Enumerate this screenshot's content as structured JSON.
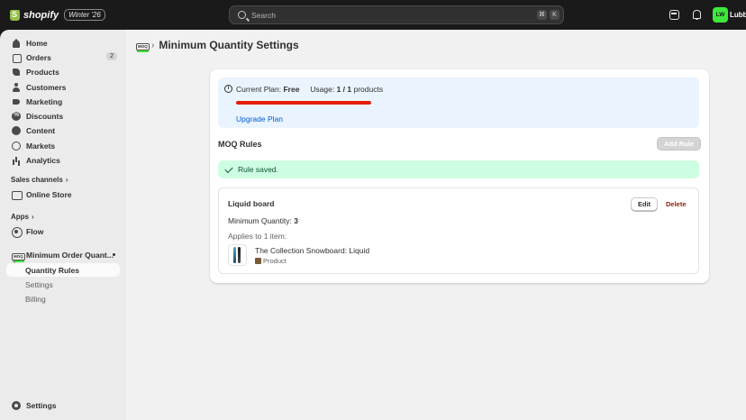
{
  "topbar": {
    "brand": "shopify",
    "version": "Winter '26",
    "search_placeholder": "Search",
    "kbd_cmd": "⌘",
    "kbd_k": "K",
    "avatar_initials": "LW",
    "account_name": "Lubbe"
  },
  "sidebar": {
    "items": [
      {
        "label": "Home",
        "icon": "home-icon"
      },
      {
        "label": "Orders",
        "icon": "orders-icon",
        "count": "2"
      },
      {
        "label": "Products",
        "icon": "tag-icon"
      },
      {
        "label": "Customers",
        "icon": "person-icon"
      },
      {
        "label": "Marketing",
        "icon": "megaphone-icon"
      },
      {
        "label": "Discounts",
        "icon": "discount-icon"
      },
      {
        "label": "Content",
        "icon": "content-icon"
      },
      {
        "label": "Markets",
        "icon": "globe-icon"
      },
      {
        "label": "Analytics",
        "icon": "chart-icon"
      }
    ],
    "sales_channels_label": "Sales channels",
    "online_store_label": "Online Store",
    "apps_label": "Apps",
    "flow_label": "Flow",
    "app_name": "Minimum Order Quant...",
    "moq_badge": "MOQ",
    "app_sub_items": [
      "Quantity Rules",
      "Settings",
      "Billing"
    ],
    "settings_label": "Settings"
  },
  "page": {
    "title": "Minimum Quantity Settings",
    "plan": {
      "current_plan_label": "Current Plan:",
      "current_plan_value": "Free",
      "usage_label": "Usage:",
      "usage_value": "1 / 1",
      "usage_unit": "products",
      "usage_fraction": 1.0,
      "upgrade_link": "Upgrade Plan"
    },
    "rules_title": "MOQ Rules",
    "add_rule_label": "Add Rule",
    "success_message": "Rule saved.",
    "rule": {
      "name": "Liquid board",
      "edit_label": "Edit",
      "delete_label": "Delete",
      "min_qty_label": "Minimum Quantity:",
      "min_qty_value": "3",
      "applies_text": "Applies to 1 item:",
      "product_name": "The Collection Snowboard: Liquid",
      "product_type": "Product"
    }
  },
  "colors": {
    "accent_link": "#005bd3",
    "progress_fill": "#e51c00",
    "success_bg": "#cdfee1",
    "info_bg": "#eaf4ff",
    "avatar_bg": "#3ee83e"
  }
}
